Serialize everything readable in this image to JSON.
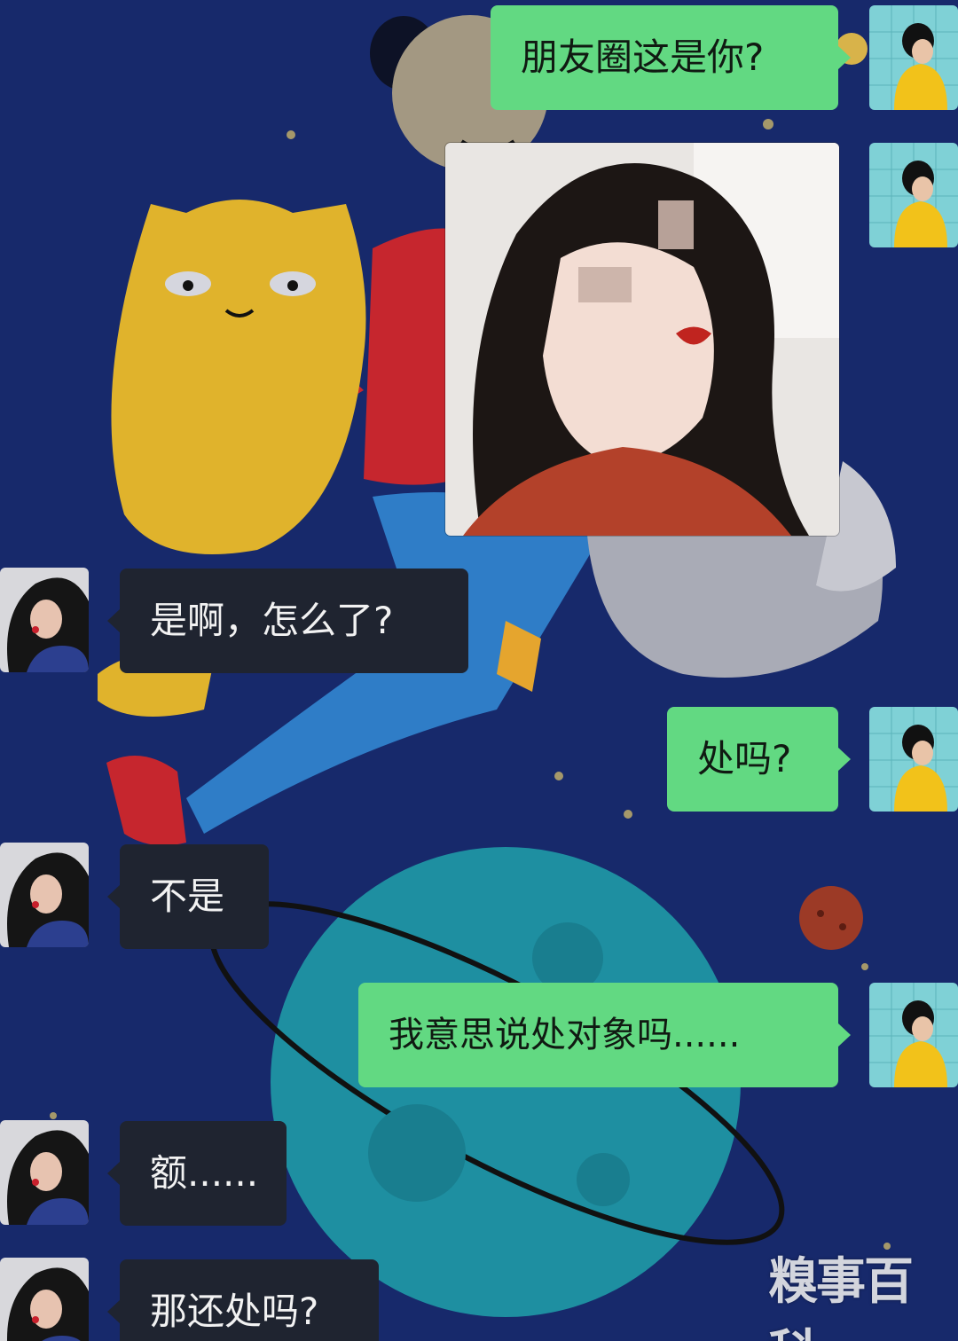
{
  "chat": {
    "messages": [
      {
        "side": "me",
        "type": "text",
        "text": "朋友圈这是你?"
      },
      {
        "side": "me",
        "type": "image",
        "icon": "selfie-photo"
      },
      {
        "side": "peer",
        "type": "text",
        "text": "是啊，怎么了?"
      },
      {
        "side": "me",
        "type": "text",
        "text": "处吗?"
      },
      {
        "side": "peer",
        "type": "text",
        "text": "不是"
      },
      {
        "side": "me",
        "type": "text",
        "text": "我意思说处对象吗......"
      },
      {
        "side": "peer",
        "type": "text",
        "text": "额......"
      },
      {
        "side": "peer",
        "type": "text",
        "text": "那还处吗?"
      }
    ]
  },
  "avatars": {
    "me": "boy-yellow-shirt-avatar",
    "peer": "girl-dark-hair-avatar"
  },
  "watermark": "糗事百科",
  "colors": {
    "background": "#17296b",
    "my_bubble": "#62d982",
    "peer_bubble": "#1f2430"
  }
}
